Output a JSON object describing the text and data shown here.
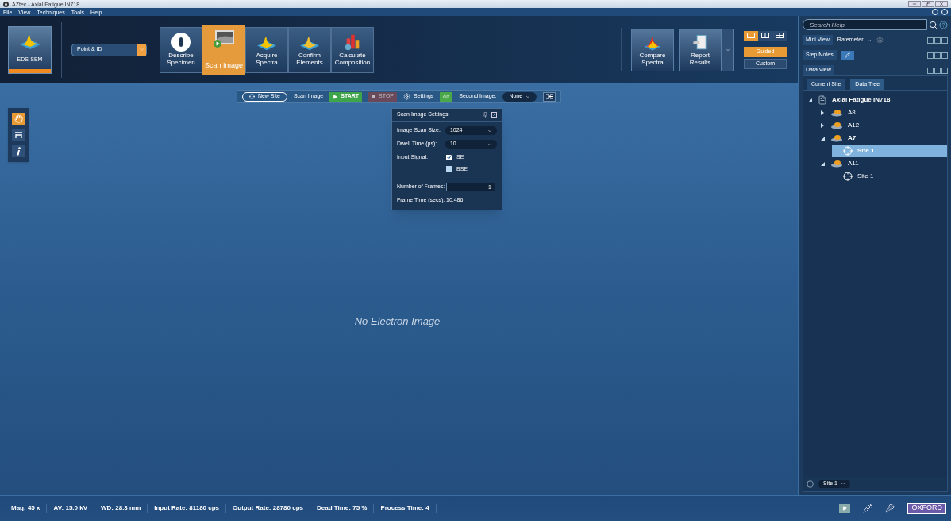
{
  "window": {
    "title": "AZtec - Axial Fatigue IN718"
  },
  "menu": [
    "File",
    "View",
    "Techniques",
    "Tools",
    "Help"
  ],
  "ribbon": {
    "mode": "EDS-SEM",
    "application": "Point & ID",
    "steps": [
      {
        "label": "Describe Specimen",
        "kind": "info",
        "selected": false
      },
      {
        "label": "Scan Image",
        "kind": "image",
        "selected": true
      },
      {
        "label": "Acquire Spectra",
        "kind": "acquire",
        "selected": false
      },
      {
        "label": "Confirm Elements",
        "kind": "confirm",
        "selected": false
      },
      {
        "label": "Calculate Composition",
        "kind": "calc",
        "selected": false
      }
    ],
    "extras": [
      {
        "label": "Compare Spectra",
        "kind": "compare"
      },
      {
        "label": "Report Results",
        "kind": "report"
      }
    ],
    "layouts": [
      {
        "kind": "single",
        "selected": true
      },
      {
        "kind": "double",
        "selected": false
      },
      {
        "kind": "quad",
        "selected": false
      }
    ],
    "modes": [
      {
        "label": "Guided",
        "selected": true
      },
      {
        "label": "Custom",
        "selected": false
      }
    ]
  },
  "toolbar": {
    "new_site": "New Site",
    "scan_label": "Scan Image",
    "start": "START",
    "stop": "STOP",
    "settings": "Settings",
    "second_image_label": "Second Image:",
    "second_image": "None"
  },
  "tools": [
    {
      "kind": "hand",
      "selected": true
    },
    {
      "kind": "select",
      "selected": false
    },
    {
      "kind": "info",
      "selected": false
    }
  ],
  "settings_panel": {
    "title": "Scan Image Settings",
    "scan_size_label": "Image Scan Size:",
    "scan_size": "1024",
    "dwell_label": "Dwell Time (µs):",
    "dwell": "10",
    "signal_label": "Input Signal:",
    "signals": [
      {
        "label": "SE",
        "checked": true
      },
      {
        "label": "BSE",
        "checked": false
      }
    ],
    "frames_label": "Number of Frames:",
    "frames": "1",
    "frame_time_label": "Frame Time (secs):",
    "frame_time": "10.486"
  },
  "canvas": {
    "message": "No Electron Image"
  },
  "side_panel": {
    "search_placeholder": "Search Help",
    "mini_view": "Mini View",
    "ratemeter": "Ratemeter",
    "step_notes": "Step Notes",
    "data_view": "Data View",
    "tabs": [
      {
        "label": "Current Site",
        "selected": false
      },
      {
        "label": "Data Tree",
        "selected": true
      }
    ],
    "tree": [
      {
        "label": "Axial Fatigue IN718",
        "kind": "project",
        "expanded": true,
        "selected": false,
        "children": [
          {
            "label": "A8",
            "kind": "specimen",
            "expanded": false,
            "selected": false
          },
          {
            "label": "A12",
            "kind": "specimen",
            "expanded": false,
            "selected": false
          },
          {
            "label": "A7",
            "kind": "specimen",
            "expanded": true,
            "selected": false,
            "children": [
              {
                "label": "Site 1",
                "kind": "site",
                "selected": true
              }
            ]
          },
          {
            "label": "A11",
            "kind": "specimen",
            "expanded": true,
            "selected": false,
            "children": [
              {
                "label": "Site 1",
                "kind": "site",
                "selected": false
              }
            ]
          }
        ]
      }
    ],
    "site_selector": "Site 1"
  },
  "status_bar": [
    "Mag: 45 x",
    "AV: 15.0 kV",
    "WD: 28.3 mm",
    "Input Rate: 81180 cps",
    "Output Rate: 28780 cps",
    "Dead Time: 75 %",
    "Process Time: 4"
  ],
  "logo": "OXFORD"
}
